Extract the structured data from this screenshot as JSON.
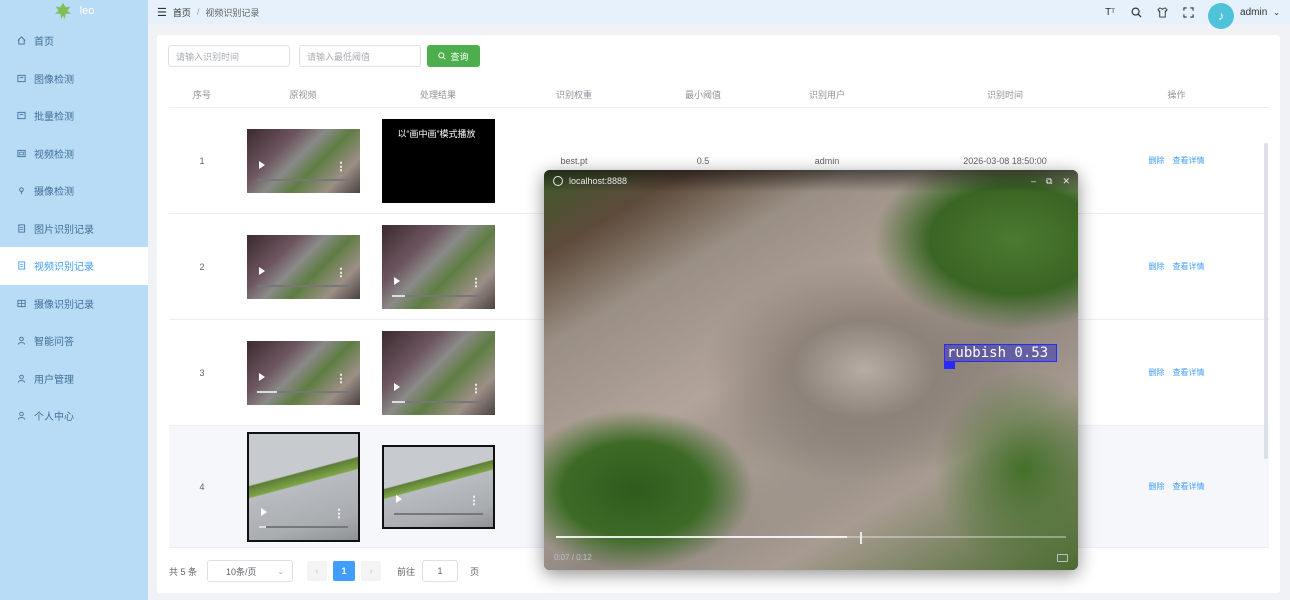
{
  "sidebar": {
    "logo_text": "leo",
    "items": [
      {
        "label": "首页",
        "icon": "home-icon",
        "active": false
      },
      {
        "label": "图像检测",
        "icon": "image-icon",
        "active": false
      },
      {
        "label": "批量检测",
        "icon": "image-icon",
        "active": false
      },
      {
        "label": "视频检测",
        "icon": "video-icon",
        "active": false
      },
      {
        "label": "摄像检测",
        "icon": "camera-icon",
        "active": false
      },
      {
        "label": "图片识别记录",
        "icon": "document-icon",
        "active": false
      },
      {
        "label": "视频识别记录",
        "icon": "document-icon",
        "active": true
      },
      {
        "label": "摄像识别记录",
        "icon": "grid-icon",
        "active": false
      },
      {
        "label": "智能问答",
        "icon": "user-icon",
        "active": false
      },
      {
        "label": "用户管理",
        "icon": "user-icon",
        "active": false
      },
      {
        "label": "个人中心",
        "icon": "user-icon",
        "active": false
      }
    ]
  },
  "header": {
    "breadcrumb_home": "首页",
    "breadcrumb_sep": "/",
    "breadcrumb_current": "视频识别记录",
    "username": "admin",
    "icons": [
      "font-size-icon",
      "search-icon",
      "shirt-icon",
      "fullscreen-icon"
    ]
  },
  "search": {
    "time_placeholder": "请输入识别时间",
    "threshold_placeholder": "请输入最低阈值",
    "query_label": "查询"
  },
  "table": {
    "headers": [
      "序号",
      "原视频",
      "处理结果",
      "识别权重",
      "最小阈值",
      "识别用户",
      "识别时间",
      "操作"
    ],
    "rows": [
      {
        "index": "1",
        "weight": "best.pt",
        "threshold": "0.5",
        "user": "admin",
        "time": "2026-03-08 18:50:00",
        "result_text": "以“画中画”模式播放"
      },
      {
        "index": "2",
        "weight": "",
        "threshold": "",
        "user": "",
        "time": ""
      },
      {
        "index": "3",
        "weight": "",
        "threshold": "",
        "user": "",
        "time": ""
      },
      {
        "index": "4",
        "weight": "",
        "threshold": "",
        "user": "",
        "time": ""
      }
    ],
    "delete_label": "删除",
    "detail_label": "查看详情"
  },
  "pager": {
    "total": "共 5 条",
    "page_size": "10条/页",
    "current_page": "1",
    "goto_label": "前往",
    "goto_value": "1",
    "page_suffix": "页"
  },
  "pip": {
    "title": "localhost:8888",
    "detection_label": "rubbish 0.53",
    "time": "0:07 / 0:12",
    "progress": 0.57
  }
}
